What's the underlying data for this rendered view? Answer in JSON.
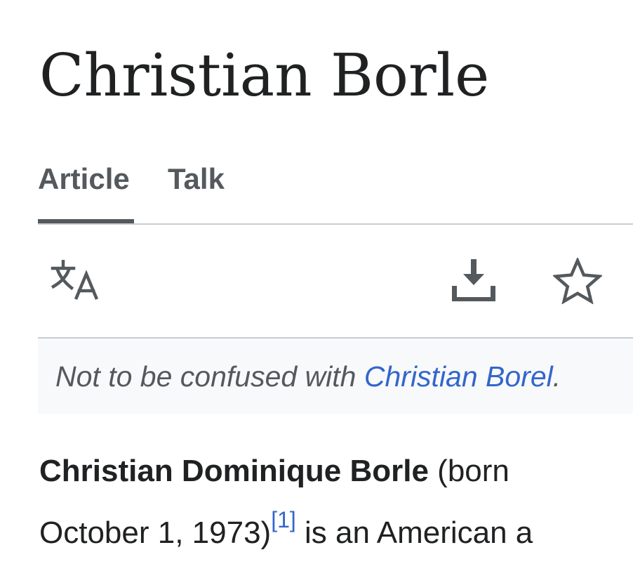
{
  "article": {
    "title": "Christian Borle"
  },
  "tabs": [
    {
      "label": "Article",
      "active": true
    },
    {
      "label": "Talk",
      "active": false
    }
  ],
  "toolbar": {
    "language_icon": "language-translate-icon",
    "download_icon": "download-icon",
    "watch_icon": "star-icon"
  },
  "hatnote": {
    "prefix": "Not to be confused with ",
    "link_text": "Christian Borel",
    "suffix": "."
  },
  "lead": {
    "bold_name": "Christian Dominique Borle",
    "born_text": " (born",
    "birth_date": "October 1, 1973)",
    "ref": "[1]",
    "continuation": " is an American a"
  },
  "colors": {
    "text": "#202122",
    "tab_text": "#54595d",
    "link": "#3366cc",
    "hatnote_bg": "#f8f9fa",
    "divider": "#c8ccd1"
  }
}
